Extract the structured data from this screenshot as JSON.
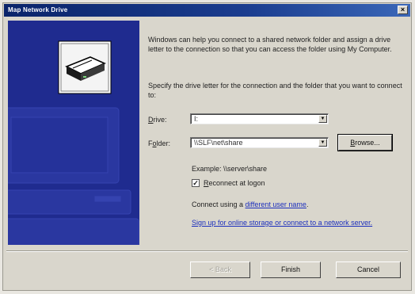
{
  "window": {
    "title": "Map Network Drive",
    "close_glyph": "×"
  },
  "colors": {
    "title_bar": "#0a246a",
    "panel": "#1f2b8f",
    "link": "#1c2fbd",
    "face": "#d9d6cc"
  },
  "left_panel": {
    "icons": [
      "network-drive-icon",
      "computer-icon"
    ]
  },
  "intro_text": "Windows can help you connect to a shared network folder and assign a drive letter to the connection so that you can access the folder using My Computer.",
  "spec_text": "Specify the drive letter for the connection and the folder that you want to connect to:",
  "drive": {
    "label_prefix": "",
    "label_accel": "D",
    "label_rest": "rive:",
    "value": "I:"
  },
  "folder": {
    "label_prefix": "F",
    "label_accel": "o",
    "label_rest": "lder:",
    "value": "\\\\SLF\\net\\share"
  },
  "browse_button": {
    "accel": "B",
    "rest": "rowse..."
  },
  "example_text": "Example: \\\\server\\share",
  "reconnect": {
    "checked": true,
    "check_glyph": "✓",
    "accel": "R",
    "rest": "econnect at logon"
  },
  "connect_using": {
    "prefix": "Connect using a ",
    "link": "different user name",
    "suffix": "."
  },
  "signup_link": "Sign up for online storage or connect to a network server.",
  "footer": {
    "back_label": "< Back",
    "finish_label": "Finish",
    "cancel_label": "Cancel"
  }
}
